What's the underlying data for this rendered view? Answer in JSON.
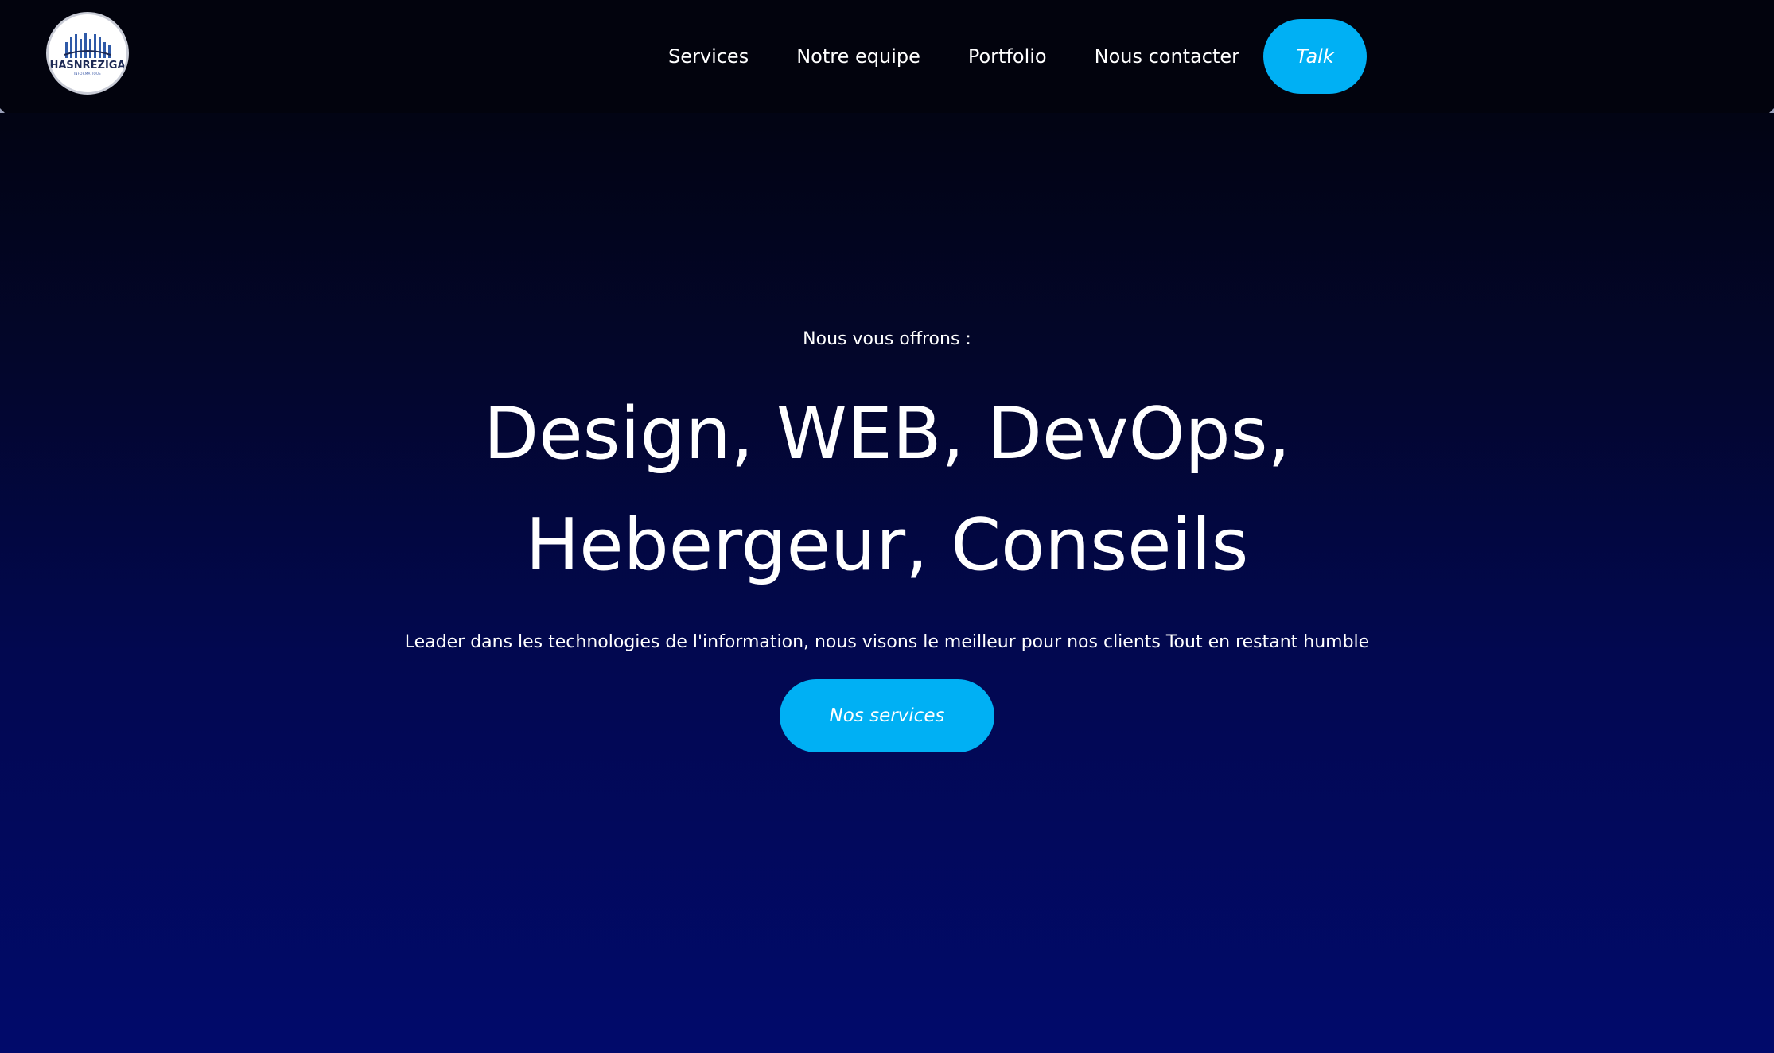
{
  "header": {
    "logo": {
      "text": "HASNREZIGA",
      "subtext": "INFORMATIQUE"
    },
    "nav": [
      {
        "label": "Services"
      },
      {
        "label": "Notre equipe"
      },
      {
        "label": "Portfolio"
      },
      {
        "label": "Nous contacter"
      }
    ],
    "cta_label": "Talk"
  },
  "hero": {
    "eyebrow": "Nous vous offrons :",
    "title_line1": "Design, WEB, DevOps,",
    "title_line2": "Hebergeur, Conseils",
    "description": "Leader dans les technologies de l'information, nous visons le meilleur pour nos clients Tout en restant humble",
    "button_label": "Nos services"
  },
  "colors": {
    "accent": "#00b0f4",
    "background_top": "#02030d",
    "background_bottom": "#010a6b",
    "text": "#ffffff"
  }
}
